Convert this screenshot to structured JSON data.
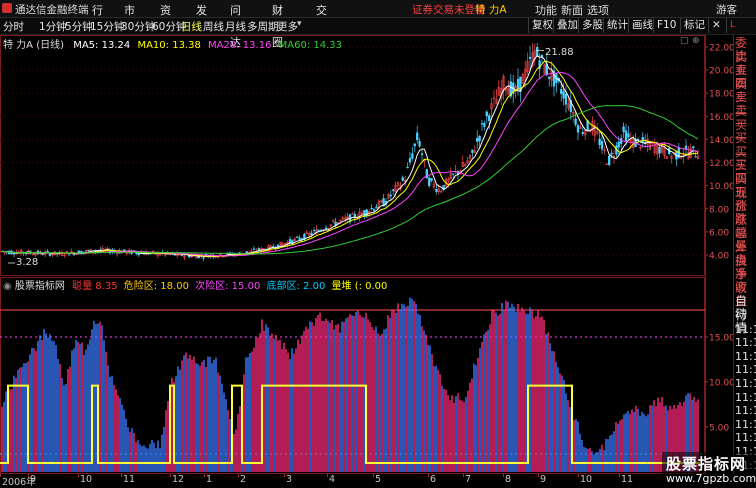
{
  "app": {
    "title": "通达信金融终端",
    "stock_title": "特 力A",
    "warning": "证券交易未登录",
    "user": "游客"
  },
  "menu": [
    "行情",
    "市场",
    "资讯",
    "发现",
    "问小达",
    "财富圈",
    "交易"
  ],
  "window_controls": [
    "功能",
    "新面",
    "选项"
  ],
  "periods": [
    {
      "label": "分时",
      "active": false
    },
    {
      "label": "1分钟",
      "active": false
    },
    {
      "label": "5分钟",
      "active": false
    },
    {
      "label": "15分钟",
      "active": false
    },
    {
      "label": "30分钟",
      "active": false
    },
    {
      "label": "60分钟",
      "active": false
    },
    {
      "label": "日线",
      "active": true
    },
    {
      "label": "周线",
      "active": false
    },
    {
      "label": "月线",
      "active": false
    },
    {
      "label": "多周期",
      "active": false
    },
    {
      "label": "更多",
      "active": false
    }
  ],
  "right_toolbar": [
    "复权",
    "叠加",
    "多股",
    "统计",
    "画线",
    "F10",
    "标记"
  ],
  "main_chart": {
    "stock_label": "特 力A (日线)",
    "ma": [
      {
        "name": "MA5",
        "value": "13.24",
        "color": "#ffffff"
      },
      {
        "name": "MA10",
        "value": "13.38",
        "color": "#ffff00"
      },
      {
        "name": "MA20",
        "value": "13.16",
        "color": "#ff44ff"
      },
      {
        "name": "MA60",
        "value": "14.33",
        "color": "#33cc33"
      }
    ],
    "high_marker": "21.88",
    "low_marker": "3.28",
    "y_ticks": [
      "22.00",
      "20.00",
      "18.00",
      "16.00",
      "14.00",
      "12.00",
      "10.00",
      "8.00",
      "6.00",
      "4.00"
    ],
    "y_values": [
      22,
      20,
      18,
      16,
      14,
      12,
      10,
      8,
      6,
      4
    ]
  },
  "indicator": {
    "name": "股票指标网",
    "items": [
      {
        "text": "聪量",
        "color": "#ff3333"
      },
      {
        "text": "8.35",
        "color": "#ff3333"
      },
      {
        "text": "危险区: 18.00",
        "color": "#ffcc00"
      },
      {
        "text": "次险区: 15.00",
        "color": "#ff44ff"
      },
      {
        "text": "底部区: 2.00",
        "color": "#00ccff"
      },
      {
        "text": "量堆 (: 0.00",
        "color": "#ffff00"
      }
    ],
    "y_ticks": [
      "15.00",
      "10.00",
      "5.00"
    ],
    "y_values": [
      15,
      10,
      5
    ]
  },
  "time_axis": [
    "2006年",
    "9",
    "10",
    "11",
    "12",
    "1",
    "2",
    "3",
    "4",
    "5",
    "6",
    "7",
    "8",
    "9",
    "10",
    "11"
  ],
  "sidebar": [
    "委比",
    "卖五",
    "卖四",
    "卖三",
    "卖二",
    "卖一",
    "买一",
    "买二",
    "买三",
    "买四",
    "买五",
    "现价",
    "涨跌",
    "涨幅",
    "总量",
    "外盘",
    "换手",
    "净资",
    "收益",
    "自动",
    "行情",
    "11:1",
    "11:1",
    "11:1",
    "11:1",
    "11:1",
    "11:1",
    "11:1",
    "11:1",
    "11:1",
    "11:1",
    "11:1"
  ],
  "watermark": {
    "line1": "股票指标网",
    "line2": "www.7gpzb.com"
  }
}
